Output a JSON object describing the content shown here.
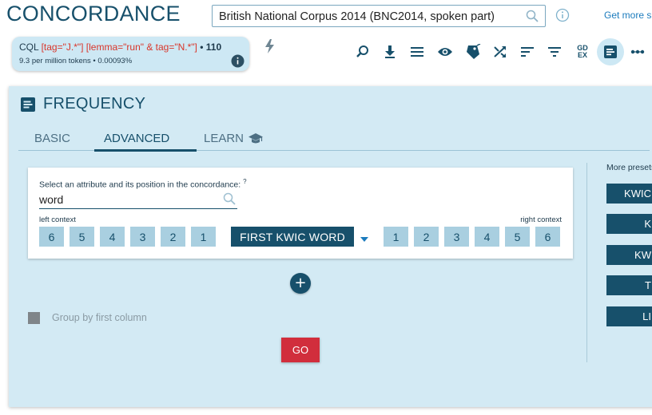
{
  "header": {
    "brand": "CONCORDANCE",
    "corpus_value": "British National Corpus 2014 (BNC2014, spoken part)",
    "get_more": "Get more sp"
  },
  "cql": {
    "label": "CQL",
    "query": "[tag=\"J.*\"] [lemma=\"run\" & tag=\"N.*\"]",
    "hits": "• 110",
    "stats": "9.3 per million tokens • 0.00093%"
  },
  "toolbar": {
    "icons": [
      "search-results-icon",
      "download-icon",
      "view-options-icon",
      "visibility-icon",
      "tag-icon",
      "shuffle-icon",
      "sort-icon",
      "filter-icon",
      "gdex-icon",
      "frequency-icon",
      "more-icon"
    ],
    "gdex_label_top": "GD",
    "gdex_label_bottom": "EX"
  },
  "frequency": {
    "title": "FREQUENCY",
    "tabs": [
      "BASIC",
      "ADVANCED",
      "LEARN"
    ],
    "active_tab": "ADVANCED",
    "attribute_label": "Select an attribute and its position in the concordance:",
    "attribute_help": "?",
    "attribute_value": "word",
    "left_context_label": "left context",
    "right_context_label": "right context",
    "left_positions": [
      "6",
      "5",
      "4",
      "3",
      "2",
      "1"
    ],
    "kwic_label": "FIRST KWIC WORD",
    "right_positions": [
      "1",
      "2",
      "3",
      "4",
      "5",
      "6"
    ],
    "add_label": "+",
    "group_label": "Group by first column",
    "go_label": "GO",
    "presets_label": "More presets",
    "presets": [
      "KWIC",
      "K",
      "KW",
      "T",
      "LI"
    ]
  },
  "colors": {
    "brand": "#17506b",
    "panel_bg": "#d3eaf4",
    "go": "#d12e3c",
    "cql_query": "#d9352a"
  }
}
